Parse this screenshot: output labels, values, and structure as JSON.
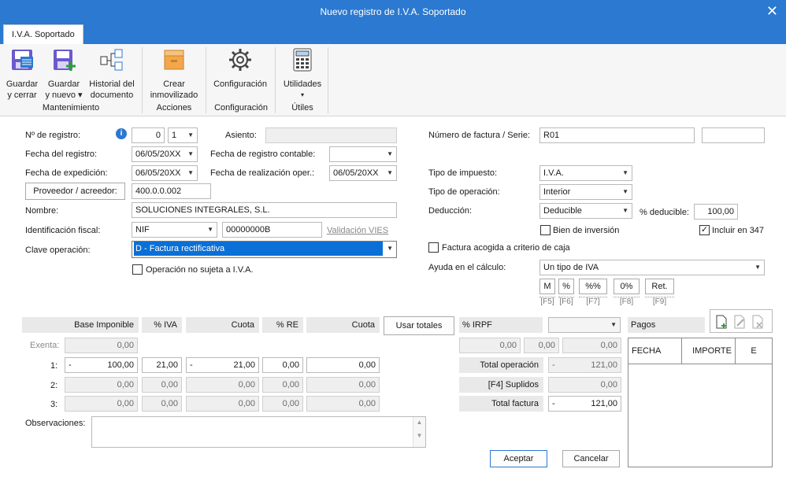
{
  "window": {
    "title": "Nuevo registro de I.V.A. Soportado"
  },
  "tab": {
    "label": "I.V.A. Soportado"
  },
  "ribbon": {
    "guardar_cerrar": [
      "Guardar",
      "y cerrar"
    ],
    "guardar_nuevo": [
      "Guardar",
      "y nuevo ▾"
    ],
    "historial": [
      "Historial del",
      "documento"
    ],
    "crear_inmov": [
      "Crear",
      "inmovilizado"
    ],
    "configuracion": "Configuración",
    "utilidades": "Utilidades",
    "groups": {
      "mantenimiento": "Mantenimiento",
      "acciones": "Acciones",
      "configuracion": "Configuración",
      "utiles": "Útiles"
    }
  },
  "form": {
    "n_registro_label": "Nº de registro:",
    "n_registro_value": "0",
    "n_registro_serie": "1",
    "asiento_label": "Asiento:",
    "fecha_registro_label": "Fecha del registro:",
    "fecha_registro": "06/05/20XX",
    "fecha_contable_label": "Fecha de registro contable:",
    "fecha_expedicion_label": "Fecha de expedición:",
    "fecha_expedicion": "06/05/20XX",
    "fecha_realizacion_label": "Fecha de realización oper.:",
    "fecha_realizacion": "06/05/20XX",
    "proveedor_button": "Proveedor / acreedor:",
    "proveedor_value": "400.0.0.002",
    "nombre_label": "Nombre:",
    "nombre_value": "SOLUCIONES INTEGRALES, S.L.",
    "ident_label": "Identificación fiscal:",
    "ident_tipo": "NIF",
    "ident_value": "00000000B",
    "validacion_vies": "Validación VIES",
    "clave_label": "Clave operación:",
    "clave_value": "D - Factura rectificativa",
    "no_sujeta": "Operación no sujeta a I.V.A.",
    "num_factura_label": "Número de factura / Serie:",
    "num_factura": "R01",
    "tipo_impuesto_label": "Tipo de impuesto:",
    "tipo_impuesto": "I.V.A.",
    "tipo_operacion_label": "Tipo de operación:",
    "tipo_operacion": "Interior",
    "deduccion_label": "Deducción:",
    "deduccion": "Deducible",
    "pct_deducible_label": "% deducible:",
    "pct_deducible": "100,00",
    "bien_inversion": "Bien de inversión",
    "incluir_347": "Incluir en 347",
    "criterio_caja": "Factura acogida a criterio de caja",
    "ayuda_label": "Ayuda en el cálculo:",
    "ayuda_value": "Un tipo de IVA",
    "calc_buttons": [
      "M",
      "%",
      "%%",
      "0%",
      "Ret."
    ],
    "calc_keys": [
      "[F5]",
      "[F6]",
      "[F7]",
      "[F8]",
      "[F9]"
    ]
  },
  "grid": {
    "headers": {
      "base": "Base Imponible",
      "pct_iva": "% IVA",
      "cuota": "Cuota",
      "pct_re": "% RE",
      "cuota_re": "Cuota",
      "usar_totales": "Usar totales",
      "irpf": "% IRPF",
      "pagos": "Pagos"
    },
    "exenta_label": "Exenta:",
    "exenta_value": "0,00",
    "rows": [
      {
        "label": "1:",
        "sign": "-",
        "base": "100,00",
        "pct_iva": "21,00",
        "cuota_sign": "-",
        "cuota": "21,00",
        "pct_re": "0,00",
        "cuota_re": "0,00"
      },
      {
        "label": "2:",
        "base": "0,00",
        "pct_iva": "0,00",
        "cuota": "0,00",
        "pct_re": "0,00",
        "cuota_re": "0,00"
      },
      {
        "label": "3:",
        "base": "0,00",
        "pct_iva": "0,00",
        "cuota": "0,00",
        "pct_re": "0,00",
        "cuota_re": "0,00"
      }
    ],
    "irpf_values": [
      "0,00",
      "0,00",
      "0,00"
    ],
    "total_operacion_label": "Total operación",
    "total_operacion_sign": "-",
    "total_operacion": "121,00",
    "suplidos_label": "[F4] Suplidos",
    "suplidos": "0,00",
    "total_factura_label": "Total factura",
    "total_factura_sign": "-",
    "total_factura": "121,00"
  },
  "pagos": {
    "columns": [
      "FECHA",
      "IMPORTE",
      "E"
    ]
  },
  "observaciones_label": "Observaciones:",
  "buttons": {
    "aceptar": "Aceptar",
    "cancelar": "Cancelar"
  }
}
